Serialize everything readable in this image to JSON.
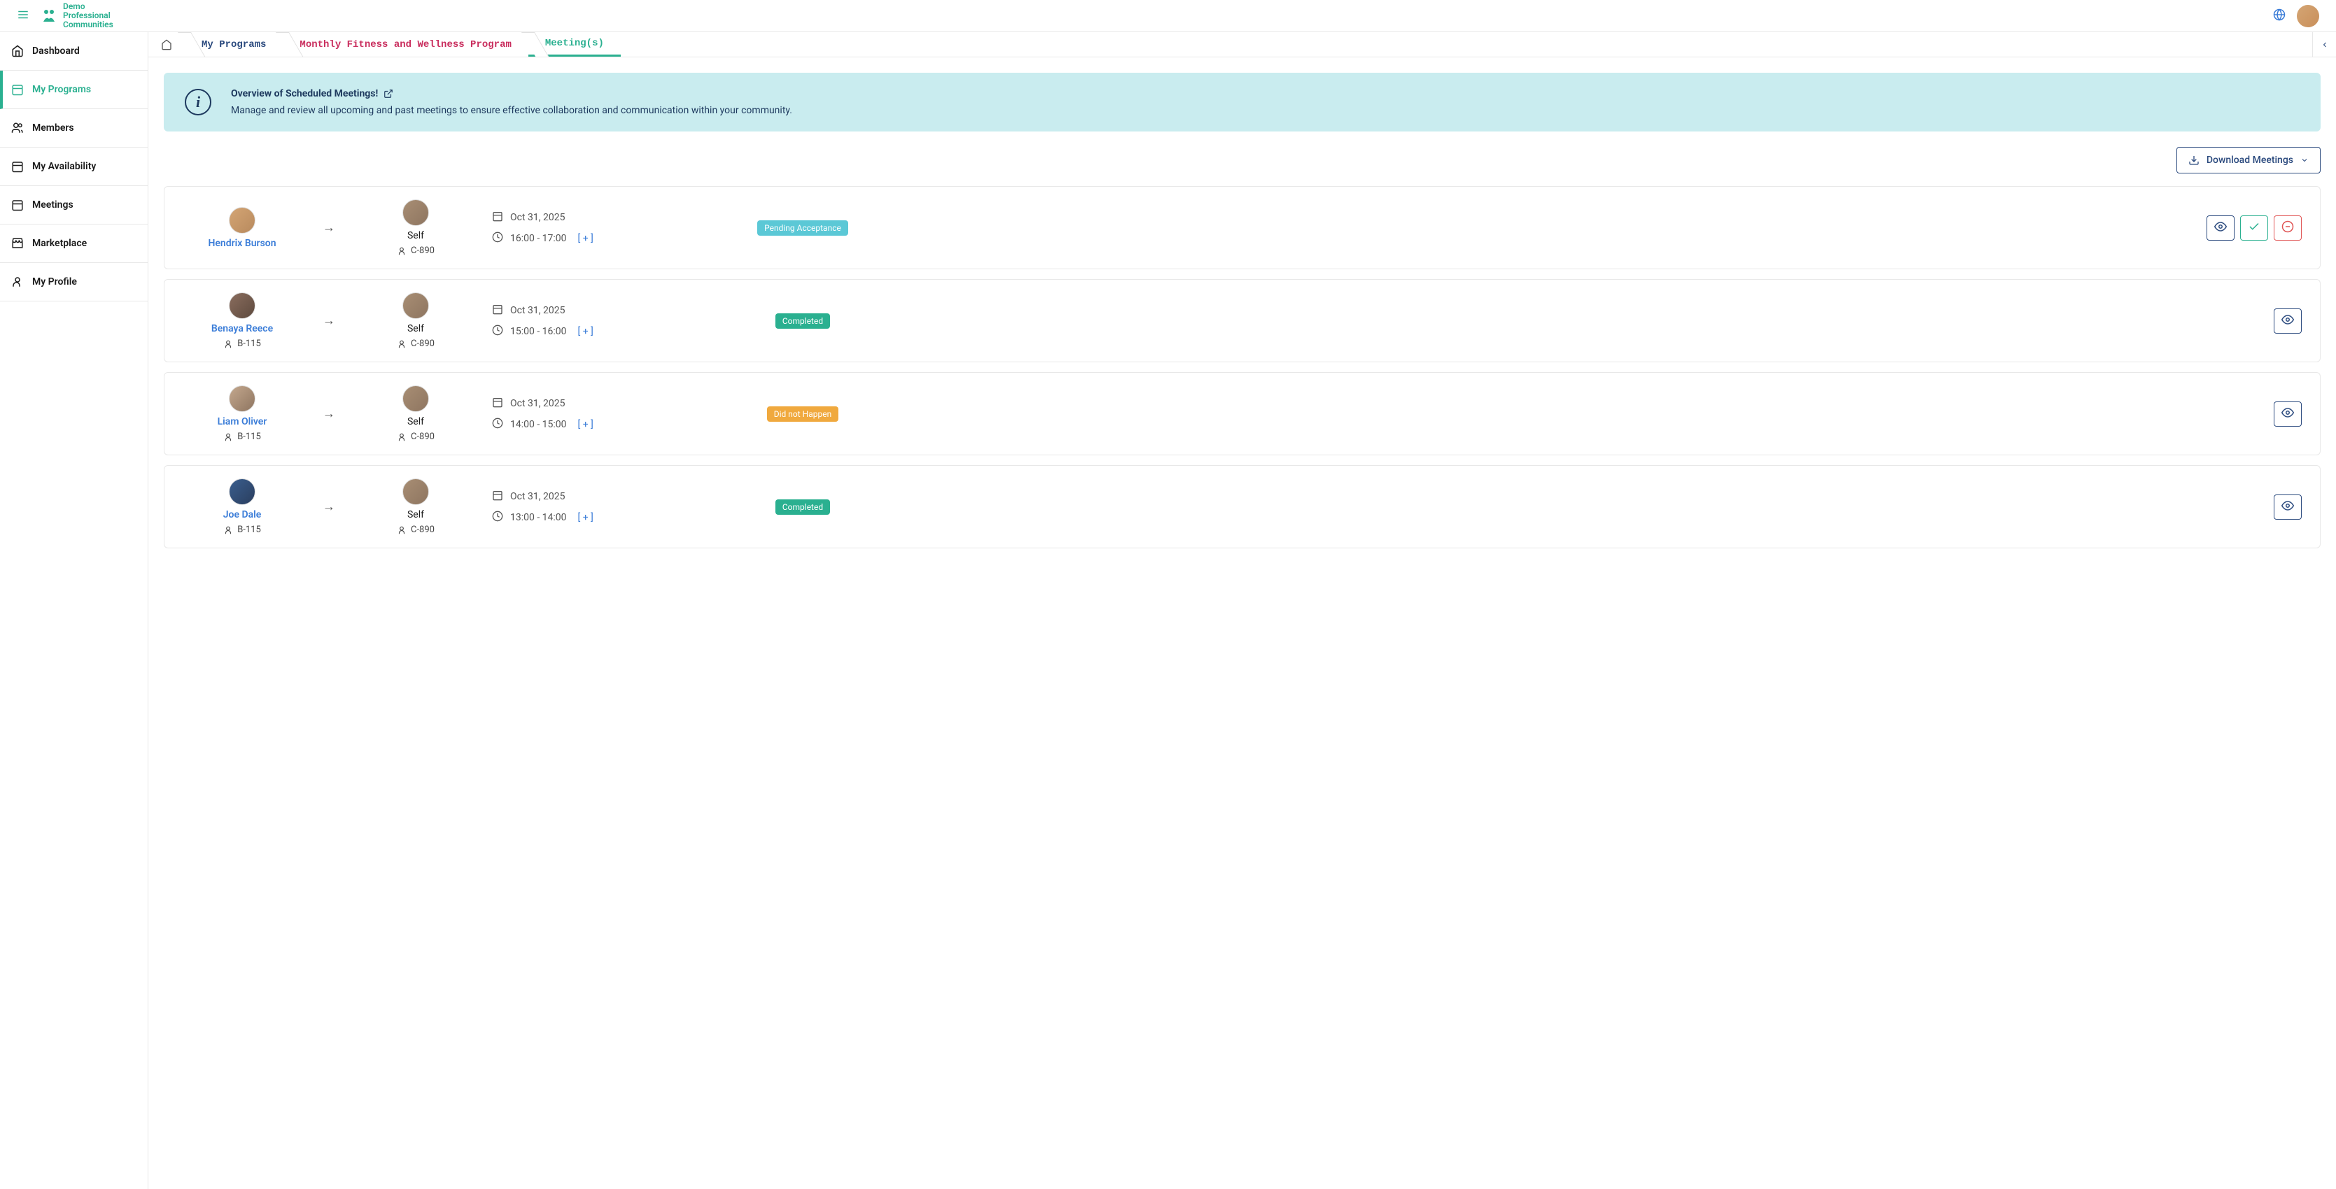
{
  "app": {
    "name_line1": "Demo",
    "name_line2": "Professional",
    "name_line3": "Communities"
  },
  "sidebar": {
    "items": [
      {
        "label": "Dashboard",
        "icon": "home"
      },
      {
        "label": "My Programs",
        "icon": "calendar",
        "active": true
      },
      {
        "label": "Members",
        "icon": "users"
      },
      {
        "label": "My Availability",
        "icon": "calendar"
      },
      {
        "label": "Meetings",
        "icon": "calendar"
      },
      {
        "label": "Marketplace",
        "icon": "store"
      },
      {
        "label": "My Profile",
        "icon": "user"
      }
    ]
  },
  "breadcrumbs": {
    "my_programs": "My Programs",
    "program": "Monthly Fitness and Wellness Program",
    "meetings": "Meeting(s)"
  },
  "info_banner": {
    "title": "Overview of Scheduled Meetings!",
    "description": "Manage and review all upcoming and past meetings to ensure effective collaboration and communication within your community."
  },
  "download_btn": "Download Meetings",
  "expand_label": "[ + ]",
  "status_labels": {
    "pending": "Pending Acceptance",
    "completed": "Completed",
    "did_not_happen": "Did not Happen"
  },
  "meetings": [
    {
      "from": {
        "name": "Hendrix Burson",
        "id": ""
      },
      "to": {
        "name": "Self",
        "id": "C-890"
      },
      "date": "Oct 31, 2025",
      "time": "16:00 - 17:00",
      "status": "pending",
      "actions": [
        "view",
        "accept",
        "reject"
      ]
    },
    {
      "from": {
        "name": "Benaya Reece",
        "id": "B-115"
      },
      "to": {
        "name": "Self",
        "id": "C-890"
      },
      "date": "Oct 31, 2025",
      "time": "15:00 - 16:00",
      "status": "completed",
      "actions": [
        "view"
      ]
    },
    {
      "from": {
        "name": "Liam Oliver",
        "id": "B-115"
      },
      "to": {
        "name": "Self",
        "id": "C-890"
      },
      "date": "Oct 31, 2025",
      "time": "14:00 - 15:00",
      "status": "did_not_happen",
      "actions": [
        "view"
      ]
    },
    {
      "from": {
        "name": "Joe Dale",
        "id": "B-115"
      },
      "to": {
        "name": "Self",
        "id": "C-890"
      },
      "date": "Oct 31, 2025",
      "time": "13:00 - 14:00",
      "status": "completed",
      "actions": [
        "view"
      ]
    }
  ]
}
